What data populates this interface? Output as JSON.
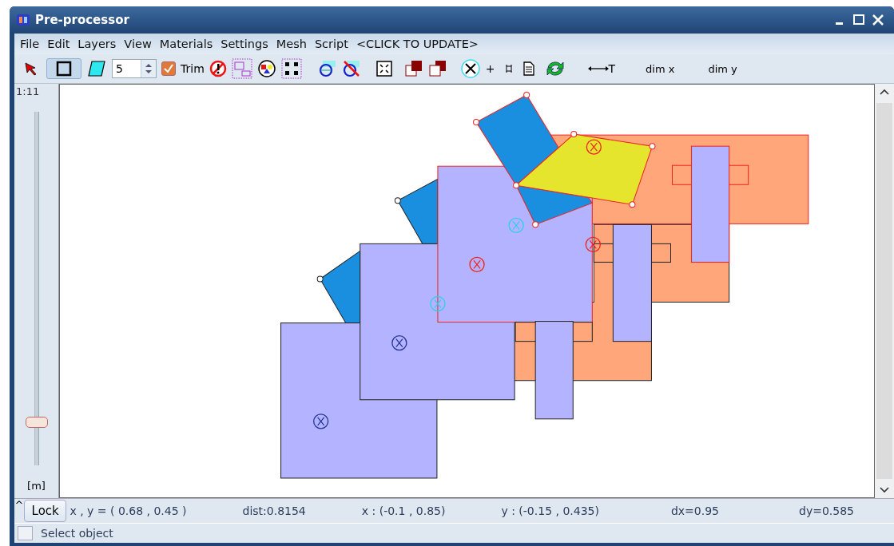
{
  "window": {
    "title": "Pre-processor"
  },
  "menu": [
    "File",
    "Edit",
    "Layers",
    "View",
    "Materials",
    "Settings",
    "Mesh",
    "Script",
    "<CLICK TO UPDATE>"
  ],
  "toolbar": {
    "rectangle_tool_selected": true,
    "spin_value": "5",
    "trim": {
      "label": "Trim",
      "checked": true
    },
    "plus": "+",
    "dimension_label": "T",
    "dim_x": "dim x",
    "dim_y": "dim y"
  },
  "zoom_slider": {
    "scale": "1:11",
    "level": 0.12,
    "unit": "[m]"
  },
  "status_bar": {
    "toggle": "^",
    "lock": "Lock",
    "xy": "x , y = ( 0.68 ,  0.45 )",
    "dist": "dist:0.8154",
    "x_range": "x :  (-0.1 ,  0.85)",
    "y_range": "y :  (-0.15 ,  0.435)",
    "dx": "dx=0.95",
    "dy": "dy=0.585"
  },
  "message": {
    "checked": false,
    "text": "Select object"
  }
}
